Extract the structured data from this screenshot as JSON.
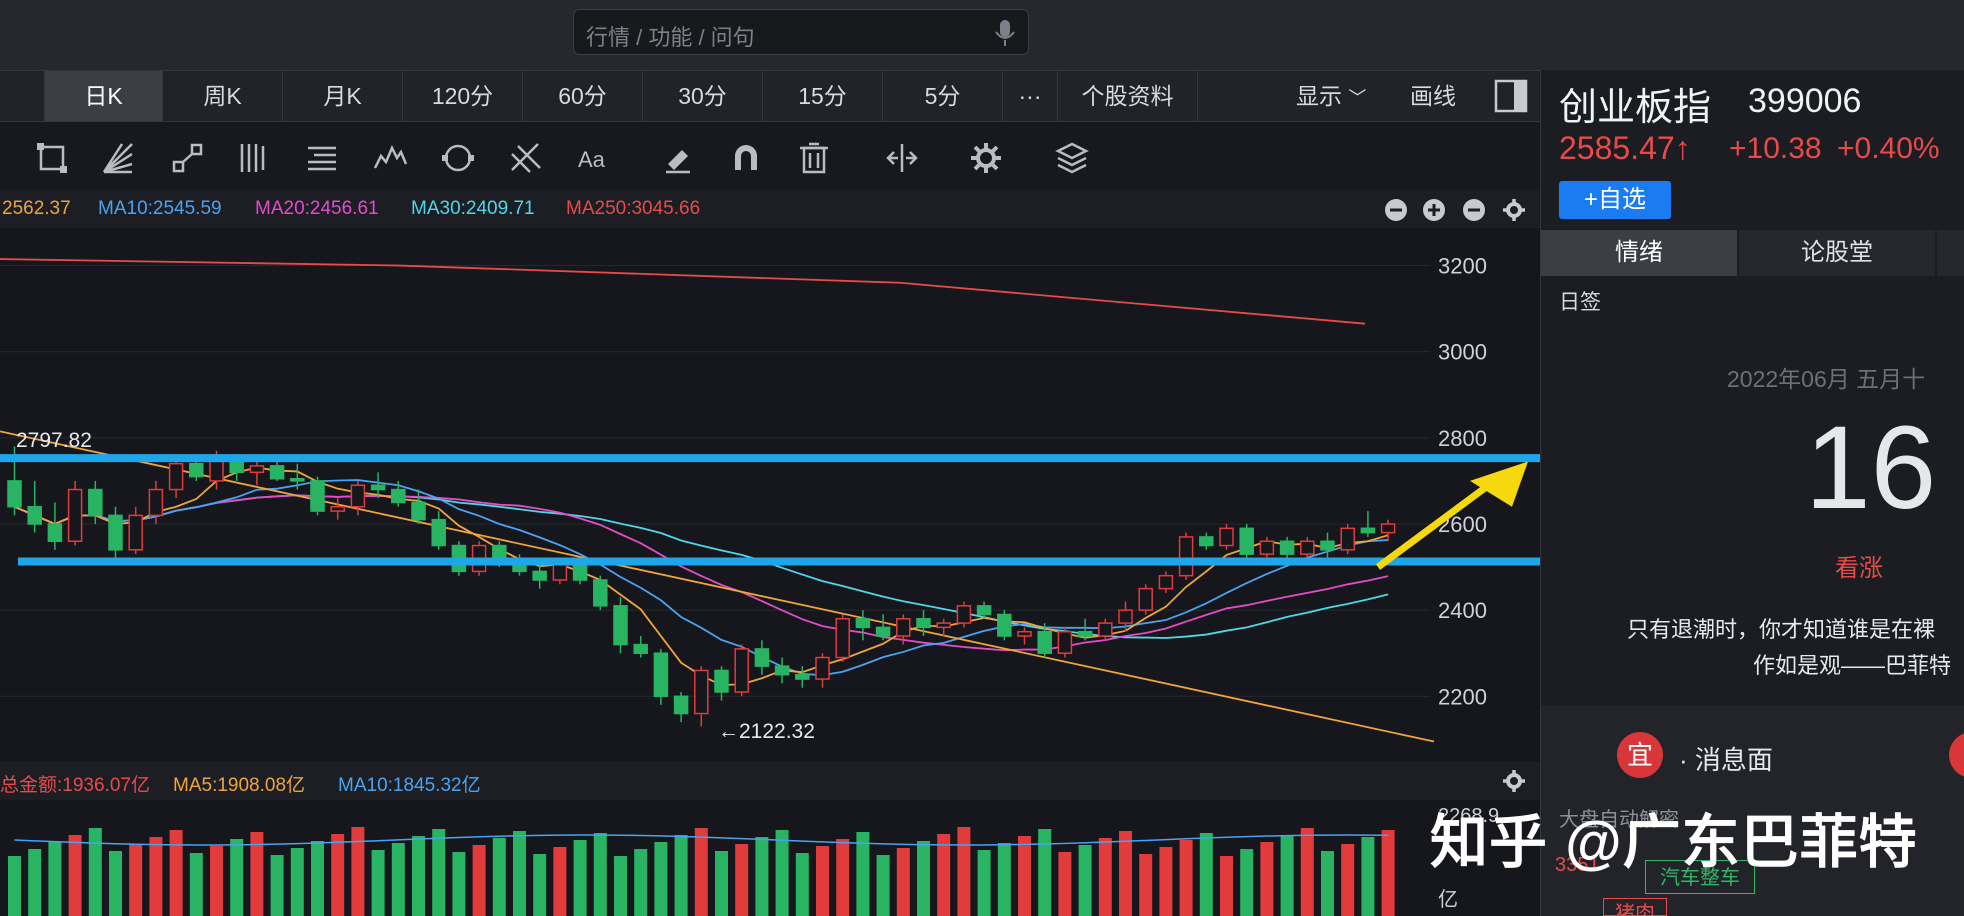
{
  "search": {
    "placeholder": "行情 / 功能 / 问句"
  },
  "tabs": {
    "left_stub": "",
    "day": "日K",
    "week": "周K",
    "month": "月K",
    "m120": "120分",
    "m60": "60分",
    "m30": "30分",
    "m15": "15分",
    "m5": "5分",
    "more": "···",
    "profile": "个股资料",
    "display": "显示",
    "draw": "画线"
  },
  "ma": {
    "ma5": "2562.37",
    "ma10": "MA10:2545.59",
    "ma20": "MA20:2456.61",
    "ma30": "MA30:2409.71",
    "ma250": "MA250:3045.66"
  },
  "colors": {
    "up": "#e23b3b",
    "down": "#28b463",
    "ma5": "#f0a43c",
    "ma10": "#4aa3f0",
    "ma20": "#e44cc7",
    "ma30": "#4fd6e8",
    "ma250": "#e84a4a",
    "hline": "#1ea6ea",
    "arrow": "#f5d90e",
    "trend": "#f0a43c"
  },
  "chart_data": {
    "type": "candlestick",
    "y_axis_labels": [
      "3200",
      "3000",
      "2800",
      "2600",
      "2400",
      "2200"
    ],
    "ylim": [
      2080,
      3250
    ],
    "annotations": {
      "high": "2797.82",
      "low": "←2122.32"
    },
    "candles": [
      [
        2700,
        2780,
        2620,
        2640
      ],
      [
        2640,
        2700,
        2580,
        2600
      ],
      [
        2600,
        2650,
        2540,
        2560
      ],
      [
        2560,
        2700,
        2550,
        2680
      ],
      [
        2680,
        2700,
        2600,
        2620
      ],
      [
        2620,
        2640,
        2520,
        2540
      ],
      [
        2540,
        2640,
        2530,
        2620
      ],
      [
        2620,
        2700,
        2600,
        2680
      ],
      [
        2680,
        2750,
        2660,
        2740
      ],
      [
        2740,
        2760,
        2700,
        2710
      ],
      [
        2700,
        2770,
        2680,
        2750
      ],
      [
        2750,
        2760,
        2700,
        2720
      ],
      [
        2720,
        2745,
        2690,
        2735
      ],
      [
        2735,
        2750,
        2700,
        2705
      ],
      [
        2705,
        2740,
        2680,
        2700
      ],
      [
        2700,
        2710,
        2620,
        2630
      ],
      [
        2630,
        2660,
        2610,
        2640
      ],
      [
        2640,
        2700,
        2620,
        2690
      ],
      [
        2690,
        2720,
        2660,
        2680
      ],
      [
        2680,
        2700,
        2640,
        2650
      ],
      [
        2650,
        2680,
        2600,
        2610
      ],
      [
        2610,
        2630,
        2540,
        2550
      ],
      [
        2550,
        2560,
        2480,
        2490
      ],
      [
        2490,
        2560,
        2480,
        2550
      ],
      [
        2550,
        2560,
        2500,
        2510
      ],
      [
        2510,
        2530,
        2480,
        2490
      ],
      [
        2490,
        2510,
        2450,
        2470
      ],
      [
        2470,
        2520,
        2460,
        2510
      ],
      [
        2510,
        2520,
        2460,
        2470
      ],
      [
        2470,
        2480,
        2400,
        2410
      ],
      [
        2410,
        2430,
        2300,
        2320
      ],
      [
        2320,
        2340,
        2290,
        2300
      ],
      [
        2300,
        2310,
        2180,
        2200
      ],
      [
        2200,
        2210,
        2140,
        2160
      ],
      [
        2160,
        2270,
        2130,
        2260
      ],
      [
        2260,
        2270,
        2190,
        2210
      ],
      [
        2210,
        2320,
        2200,
        2310
      ],
      [
        2310,
        2330,
        2250,
        2270
      ],
      [
        2270,
        2290,
        2230,
        2250
      ],
      [
        2250,
        2270,
        2220,
        2240
      ],
      [
        2240,
        2300,
        2220,
        2290
      ],
      [
        2290,
        2390,
        2280,
        2380
      ],
      [
        2380,
        2400,
        2330,
        2360
      ],
      [
        2360,
        2390,
        2330,
        2340
      ],
      [
        2340,
        2390,
        2320,
        2380
      ],
      [
        2380,
        2400,
        2340,
        2360
      ],
      [
        2360,
        2380,
        2340,
        2370
      ],
      [
        2370,
        2420,
        2360,
        2410
      ],
      [
        2410,
        2420,
        2380,
        2390
      ],
      [
        2390,
        2400,
        2330,
        2340
      ],
      [
        2340,
        2360,
        2320,
        2350
      ],
      [
        2350,
        2370,
        2290,
        2300
      ],
      [
        2300,
        2360,
        2290,
        2350
      ],
      [
        2350,
        2380,
        2330,
        2340
      ],
      [
        2340,
        2380,
        2330,
        2370
      ],
      [
        2370,
        2420,
        2350,
        2400
      ],
      [
        2400,
        2460,
        2390,
        2450
      ],
      [
        2450,
        2490,
        2440,
        2480
      ],
      [
        2480,
        2580,
        2470,
        2570
      ],
      [
        2570,
        2580,
        2540,
        2550
      ],
      [
        2550,
        2600,
        2540,
        2590
      ],
      [
        2590,
        2600,
        2520,
        2530
      ],
      [
        2530,
        2570,
        2520,
        2560
      ],
      [
        2560,
        2570,
        2520,
        2530
      ],
      [
        2530,
        2570,
        2510,
        2560
      ],
      [
        2560,
        2580,
        2520,
        2540
      ],
      [
        2540,
        2600,
        2530,
        2590
      ],
      [
        2590,
        2630,
        2570,
        2580
      ],
      [
        2580,
        2610,
        2560,
        2600
      ]
    ],
    "volume_labels": [
      "2268.9",
      "亿"
    ]
  },
  "volume": {
    "total": "总金额:1936.07亿",
    "ma5": "MA5:1908.08亿",
    "ma10": "MA10:1845.32亿"
  },
  "stock": {
    "name": "创业板指",
    "code": "399006",
    "price": "2585.47↑",
    "change": "+10.38",
    "pct": "+0.40%",
    "add": "+自选"
  },
  "panel": {
    "tab1": "情绪",
    "tab2": "论股堂",
    "tag": "日签",
    "date": "2022年06月 五月十",
    "day": "16",
    "mood": "看涨",
    "quote1": "只有退潮时，你才知道谁是在裸",
    "quote2": "作如是观——巴菲特",
    "yi": "宜",
    "news": "· 消息面",
    "sub": "大盘自动解密",
    "num": "3351",
    "sector": "汽车整车",
    "sector2": "猪肉"
  },
  "watermark": "知乎 @广东巴菲特"
}
